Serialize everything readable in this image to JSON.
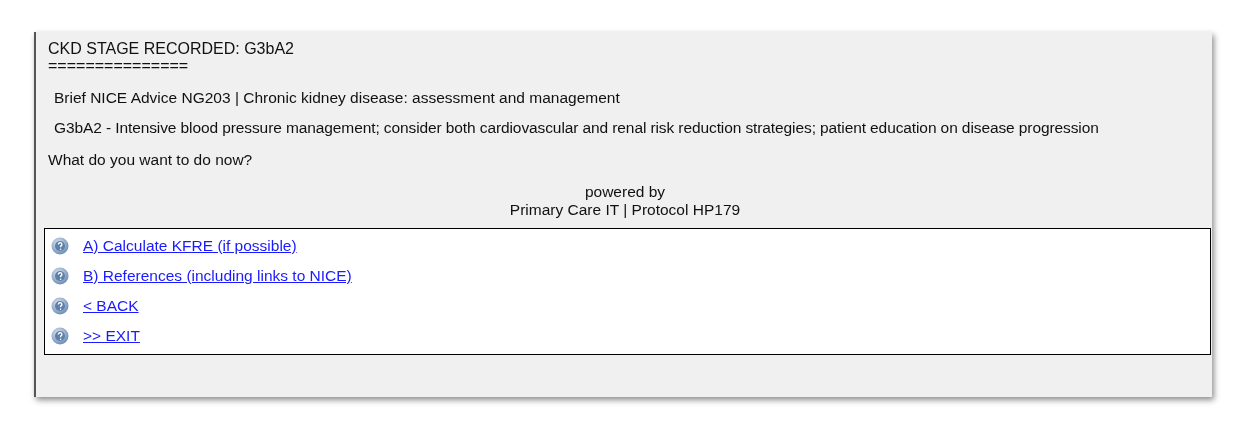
{
  "header": {
    "title": "CKD STAGE RECORDED:  G3bA2",
    "rule": "==============="
  },
  "advice": [
    "Brief NICE Advice NG203 | Chronic kidney disease: assessment and management",
    "G3bA2 - Intensive blood pressure management; consider both cardiovascular and renal risk reduction strategies; patient education on disease progression"
  ],
  "question": "What do you want to do now?",
  "footer": [
    "powered by",
    "Primary Care IT | Protocol HP179"
  ],
  "options": [
    {
      "label": "A) Calculate KFRE (if possible)"
    },
    {
      "label": "B) References (including links to NICE)"
    },
    {
      "label": "< BACK"
    },
    {
      "label": ">> EXIT"
    }
  ]
}
